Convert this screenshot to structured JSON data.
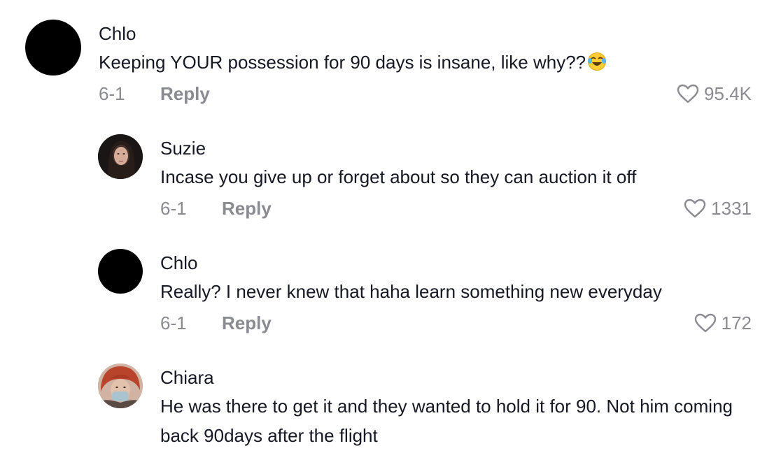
{
  "comments": [
    {
      "username": "Chlo",
      "text": "Keeping YOUR possession for 90 days is insane, like why??",
      "emoji": "😂",
      "date": "6-1",
      "reply_label": "Reply",
      "likes": "95.4K",
      "avatar": "black-circle"
    },
    {
      "username": "Suzie",
      "text": "Incase you give up or forget about so they can auction it off",
      "date": "6-1",
      "reply_label": "Reply",
      "likes": "1331",
      "avatar": "photo-dark-hair"
    },
    {
      "username": "Chlo",
      "text": "Really? I never knew that haha learn something new everyday",
      "date": "6-1",
      "reply_label": "Reply",
      "likes": "172",
      "avatar": "black-circle"
    },
    {
      "username": "Chiara",
      "text": "He was there to get it and they wanted to hold it for 90. Not him coming back 90days after the flight",
      "avatar": "photo-red-hair-mask"
    }
  ],
  "colors": {
    "text": "#161823",
    "secondary": "#8a8b91",
    "background": "#ffffff"
  },
  "icons": {
    "like": "heart-outline-icon"
  }
}
